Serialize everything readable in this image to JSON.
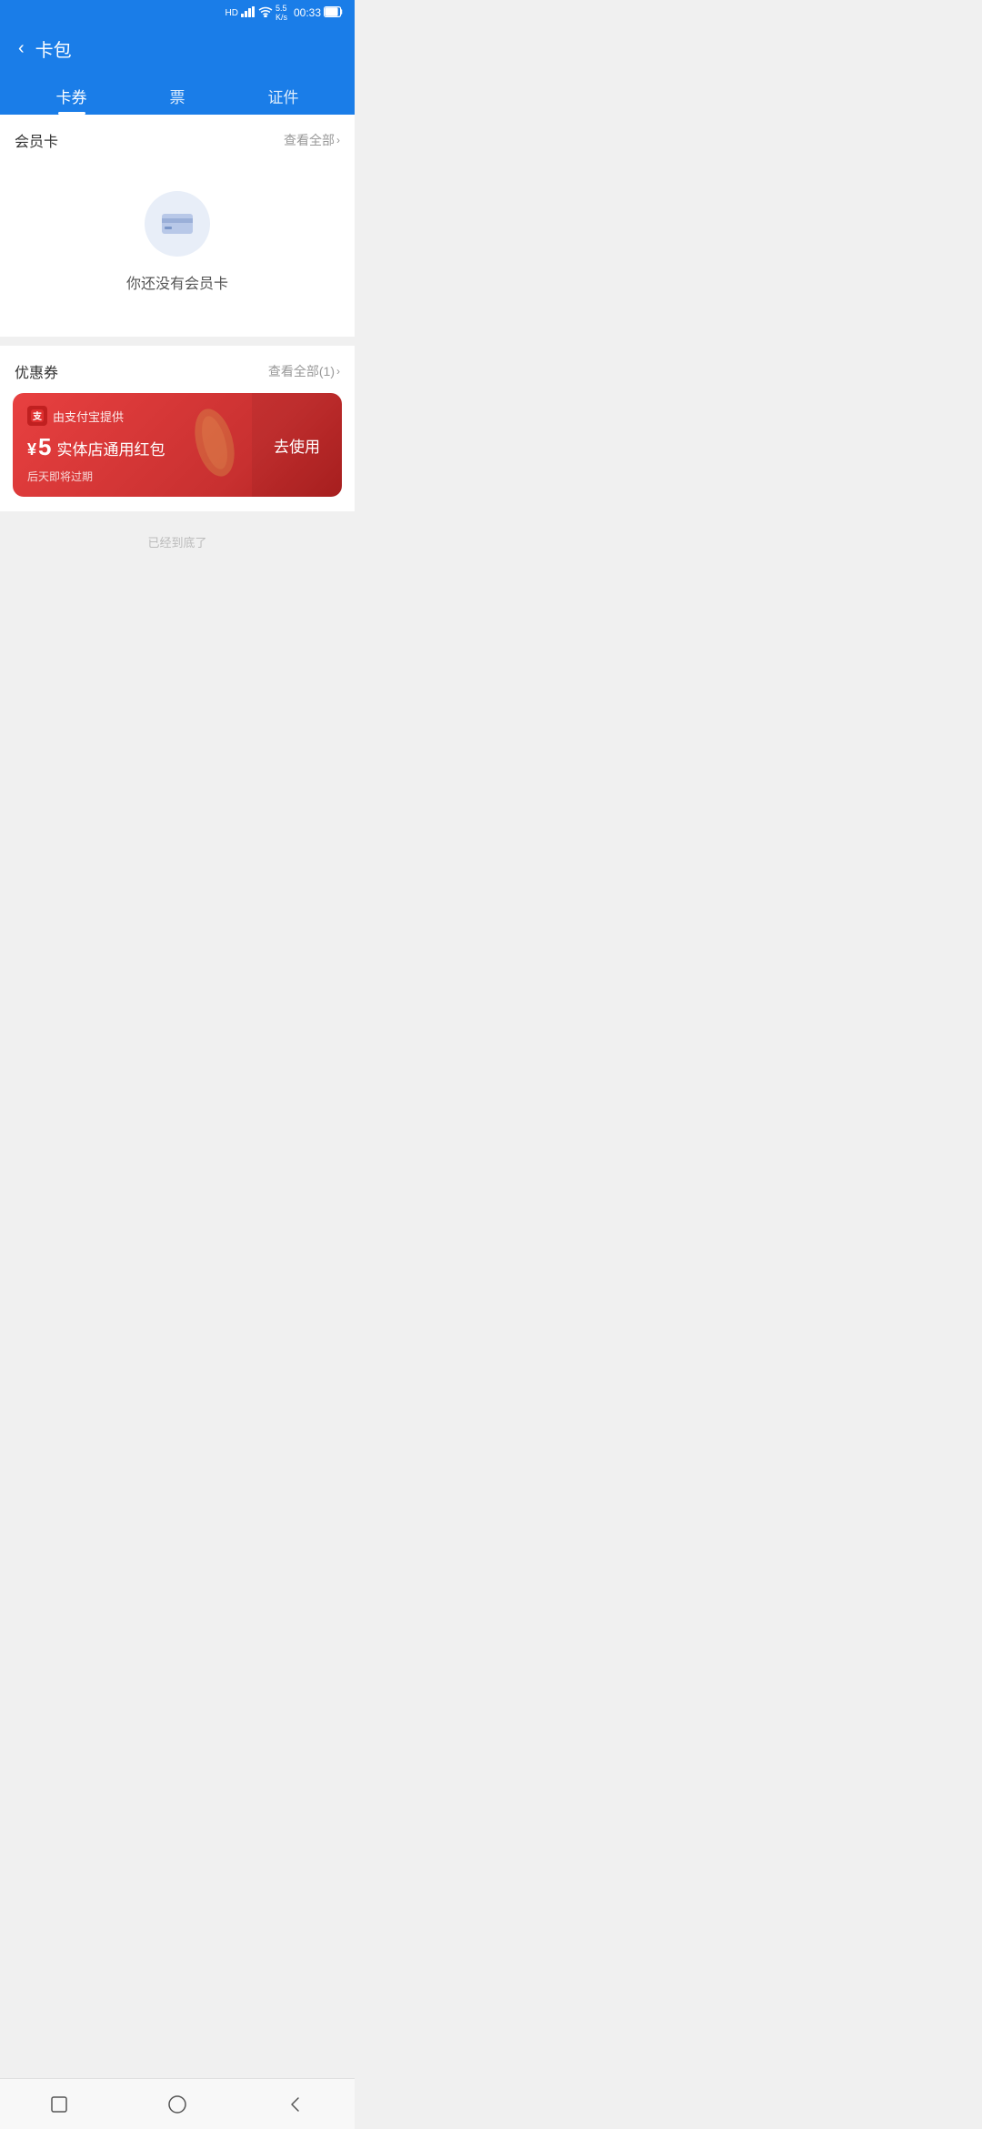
{
  "statusBar": {
    "time": "00:33",
    "network": "HD 4G",
    "signal": "5.5 K/s"
  },
  "header": {
    "backLabel": "‹",
    "title": "卡包"
  },
  "tabs": [
    {
      "id": "cards",
      "label": "卡券",
      "active": true
    },
    {
      "id": "tickets",
      "label": "票",
      "active": false
    },
    {
      "id": "certs",
      "label": "证件",
      "active": false
    }
  ],
  "memberCardSection": {
    "title": "会员卡",
    "linkLabel": "查看全部",
    "emptyText": "你还没有会员卡"
  },
  "couponSection": {
    "title": "优惠券",
    "linkLabel": "查看全部(1)",
    "coupon": {
      "provider": "由支付宝提供",
      "currencySymbol": "¥",
      "amount": "5",
      "name": "实体店通用红包",
      "expiry": "后天即将过期",
      "actionLabel": "去使用"
    }
  },
  "bottomText": "已经到底了",
  "navBar": {
    "square": "square-icon",
    "home": "home-icon",
    "back": "back-icon"
  }
}
